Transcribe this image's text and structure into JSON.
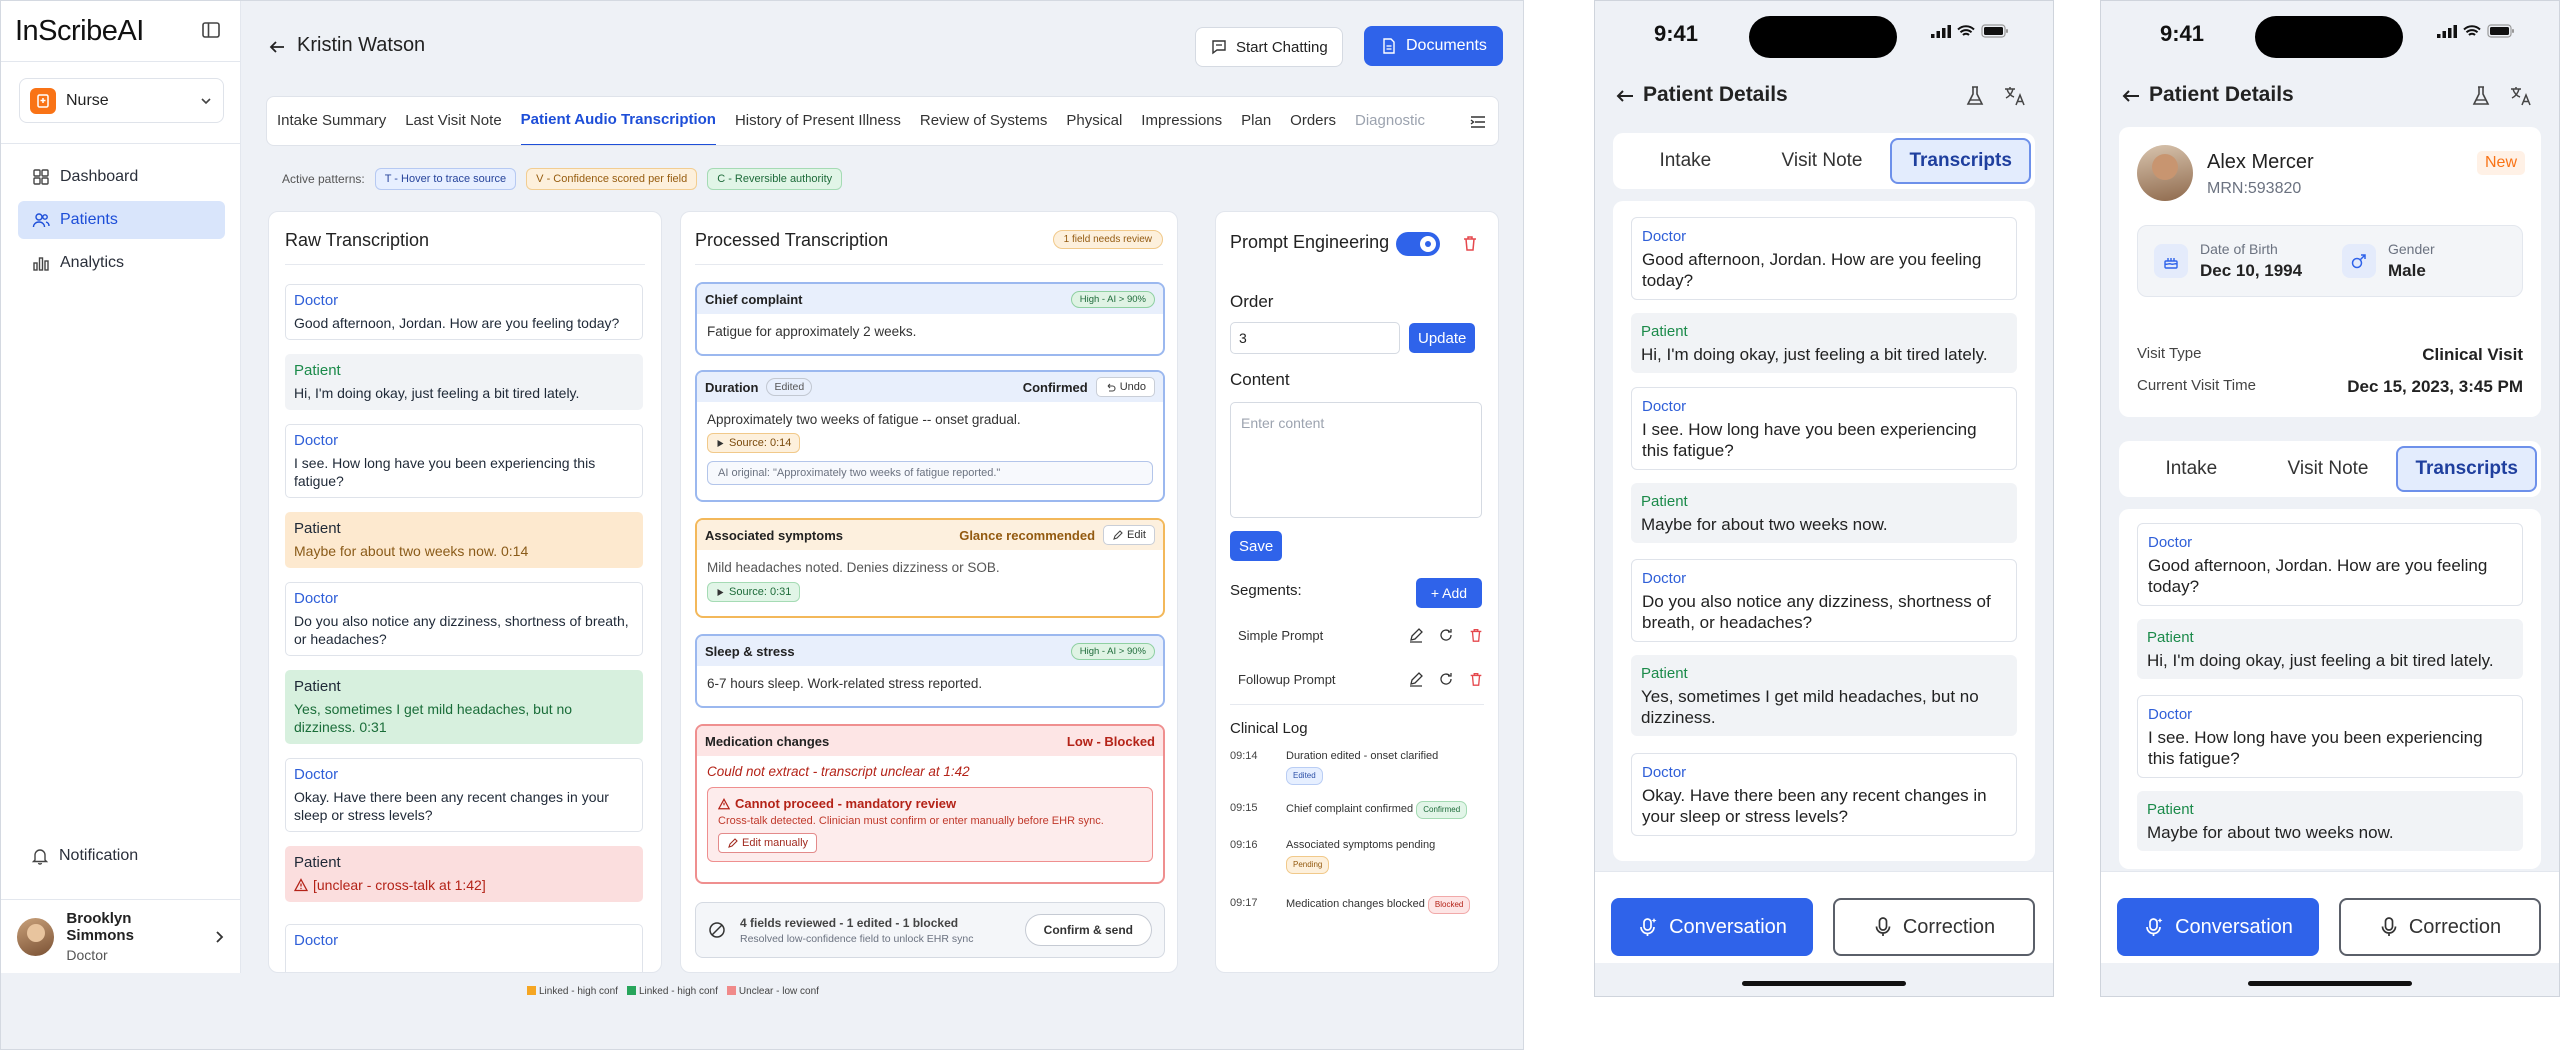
{
  "app": {
    "logo": "InScribeAI",
    "role": "Nurse",
    "nav": [
      {
        "label": "Dashboard",
        "active": false
      },
      {
        "label": "Patients",
        "active": true
      },
      {
        "label": "Analytics",
        "active": false
      }
    ],
    "notification": "Notification",
    "user": {
      "name": "Brooklyn Simmons",
      "role": "Doctor"
    }
  },
  "header": {
    "patient_name": "Kristin Watson",
    "start_chatting": "Start Chatting",
    "documents": "Documents"
  },
  "tabs": [
    "Intake Summary",
    "Last Visit Note",
    "Patient Audio Transcription",
    "History of Present Illness",
    "Review of Systems",
    "Physical",
    "Impressions",
    "Plan",
    "Orders",
    "Diagnostic"
  ],
  "active_tab": "Patient Audio Transcription",
  "patterns": {
    "label": "Active patterns:",
    "chips": [
      {
        "text": "T - Hover to trace source",
        "tone": "blue"
      },
      {
        "text": "V - Confidence scored per field",
        "tone": "orange"
      },
      {
        "text": "C - Reversible authority",
        "tone": "green"
      }
    ]
  },
  "raw": {
    "title": "Raw Transcription",
    "messages": [
      {
        "speaker": "Doctor",
        "text": "Good afternoon, Jordan. How are you feeling today?",
        "style": "doctor"
      },
      {
        "speaker": "Patient",
        "text": "Hi, I'm doing okay, just feeling a bit tired lately.",
        "style": "patient"
      },
      {
        "speaker": "Doctor",
        "text": "I see. How long have you been experiencing this fatigue?",
        "style": "doctor"
      },
      {
        "speaker": "Patient",
        "text": "Maybe for about two weeks now. 0:14",
        "style": "orange"
      },
      {
        "speaker": "Doctor",
        "text": "Do you also notice any dizziness, shortness of breath, or headaches?",
        "style": "doctor"
      },
      {
        "speaker": "Patient",
        "text": "Yes, sometimes I get mild headaches, but no dizziness. 0:31",
        "style": "green"
      },
      {
        "speaker": "Doctor",
        "text": "Okay. Have there been any recent changes in your sleep or stress levels?",
        "style": "doctor"
      },
      {
        "speaker": "Patient",
        "text": "[unclear - cross-talk at 1:42]",
        "style": "red"
      },
      {
        "speaker": "Doctor",
        "text": "",
        "style": "doctor"
      }
    ]
  },
  "processed": {
    "title": "Processed Transcription",
    "review_badge": "1 field needs review",
    "chief": {
      "label": "Chief complaint",
      "conf": "High - AI > 90%",
      "text": "Fatigue for approximately 2 weeks."
    },
    "duration": {
      "label": "Duration",
      "tag": "Edited",
      "status": "Confirmed",
      "undo": "Undo",
      "text": "Approximately two weeks of fatigue -- onset gradual.",
      "source": "Source: 0:14",
      "ai_original": "AI original: \"Approximately two weeks of fatigue reported.\""
    },
    "symptoms": {
      "label": "Associated symptoms",
      "status": "Glance recommended",
      "edit": "Edit",
      "text": "Mild headaches noted. Denies dizziness or SOB.",
      "source": "Source: 0:31"
    },
    "sleep": {
      "label": "Sleep & stress",
      "conf": "High - AI > 90%",
      "text": "6-7 hours sleep. Work-related stress reported."
    },
    "medication": {
      "label": "Medication changes",
      "status": "Low - Blocked",
      "text": "Could not extract - transcript unclear at 1:42",
      "alert_title": "Cannot proceed - mandatory review",
      "alert_desc": "Cross-talk detected. Clinician must confirm or enter manually before EHR sync.",
      "edit_manual": "Edit manually"
    },
    "summary": {
      "title": "4 fields reviewed - 1 edited - 1 blocked",
      "sub": "Resolved low-confidence field to unlock EHR sync",
      "confirm": "Confirm & send"
    }
  },
  "prompt": {
    "title": "Prompt Engineering",
    "order_label": "Order",
    "order_value": "3",
    "update": "Update",
    "content_label": "Content",
    "content_placeholder": "Enter content",
    "save": "Save",
    "segments_label": "Segments:",
    "add": "+ Add",
    "segments": [
      "Simple Prompt",
      "Followup Prompt"
    ],
    "log_title": "Clinical Log",
    "log": [
      {
        "time": "09:14",
        "text": "Duration edited - onset clarified",
        "pill": "Edited",
        "tone": "blue"
      },
      {
        "time": "09:15",
        "text": "Chief complaint confirmed",
        "pill": "Confirmed",
        "tone": "green"
      },
      {
        "time": "09:16",
        "text": "Associated symptoms pending",
        "pill": "Pending",
        "tone": "orange"
      },
      {
        "time": "09:17",
        "text": "Medication changes blocked",
        "pill": "Blocked",
        "tone": "red"
      }
    ]
  },
  "legend": [
    {
      "text": "Linked - high conf",
      "color": "#f5a623"
    },
    {
      "text": "Linked - high conf",
      "color": "#27a55b"
    },
    {
      "text": "Unclear - low conf",
      "color": "#f08a8a"
    }
  ],
  "colors": {
    "primary": "#2f63ea",
    "doctor": "#2f5fd8",
    "patient": "#1b8a4a",
    "danger": "#e5484d",
    "warning": "#f97316"
  },
  "phone1": {
    "time": "9:41",
    "title": "Patient Details",
    "tabs": [
      "Intake",
      "Visit Note",
      "Transcripts"
    ],
    "active_tab": "Transcripts",
    "messages": [
      {
        "speaker": "Doctor",
        "text": "Good afternoon, Jordan. How are you feeling today?"
      },
      {
        "speaker": "Patient",
        "text": "Hi, I'm doing okay, just feeling a bit tired lately."
      },
      {
        "speaker": "Doctor",
        "text": "I see. How long have you been experiencing this fatigue?"
      },
      {
        "speaker": "Patient",
        "text": "Maybe for about two weeks now."
      },
      {
        "speaker": "Doctor",
        "text": "Do you also notice any dizziness, shortness of breath, or headaches?"
      },
      {
        "speaker": "Patient",
        "text": "Yes, sometimes I get mild headaches, but no dizziness."
      },
      {
        "speaker": "Doctor",
        "text": "Okay. Have there been any recent changes in your sleep or stress levels?"
      }
    ],
    "conversation": "Conversation",
    "correction": "Correction"
  },
  "phone2": {
    "time": "9:41",
    "title": "Patient Details",
    "patient": {
      "name": "Alex Mercer",
      "mrn": "MRN:593820",
      "badge": "New",
      "dob_label": "Date of Birth",
      "dob": "Dec 10, 1994",
      "gender_label": "Gender",
      "gender": "Male",
      "visit_type_label": "Visit Type",
      "visit_type": "Clinical Visit",
      "visit_time_label": "Current Visit Time",
      "visit_time": "Dec 15, 2023, 3:45 PM"
    },
    "tabs": [
      "Intake",
      "Visit Note",
      "Transcripts"
    ],
    "active_tab": "Transcripts",
    "messages": [
      {
        "speaker": "Doctor",
        "text": "Good afternoon, Jordan. How are you feeling today?"
      },
      {
        "speaker": "Patient",
        "text": "Hi, I'm doing okay, just feeling a bit tired lately."
      },
      {
        "speaker": "Doctor",
        "text": "I see. How long have you been experiencing this fatigue?"
      },
      {
        "speaker": "Patient",
        "text": "Maybe for about two weeks now."
      }
    ],
    "conversation": "Conversation",
    "correction": "Correction"
  }
}
